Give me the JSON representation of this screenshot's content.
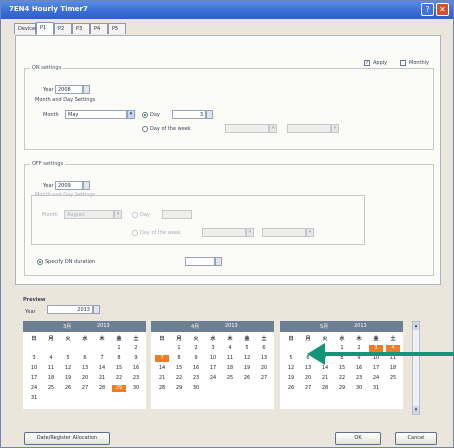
{
  "window": {
    "title": "7EN4 Hourly Timer7"
  },
  "tabs": [
    "Devices",
    "P1",
    "P2",
    "P3",
    "P4",
    "P5"
  ],
  "options": {
    "apply_label": "Apply",
    "monthly_label": "Monthly"
  },
  "on_settings": {
    "title": "ON settings",
    "year_label": "Year",
    "year_value": "2008",
    "month_day_title": "Month and Day Settings",
    "month_label": "Month",
    "month_value": "May",
    "day_label": "Day",
    "day_value": "3",
    "dow_label": "Day of the week"
  },
  "off_settings": {
    "title": "OFF settings",
    "year_label": "Year",
    "year_value": "2009",
    "month_day_title": "Month and Day Settings",
    "month_label": "Month",
    "month_value": "August",
    "day_label": "Day",
    "dow_label": "Day of the week",
    "duration_label": "Specify ON duration"
  },
  "preview": {
    "title": "Preview",
    "year_label": "Year",
    "year_value": "2013",
    "dow": [
      "日",
      "月",
      "火",
      "水",
      "木",
      "金",
      "土"
    ],
    "months": [
      {
        "name": "3月",
        "year": "2013",
        "rows": [
          [
            "",
            "",
            "",
            "",
            "",
            "1",
            "2"
          ],
          [
            "3",
            "4",
            "5",
            "6",
            "7",
            "8",
            "9"
          ],
          [
            "10",
            "11",
            "12",
            "13",
            "14",
            "15",
            "16"
          ],
          [
            "17",
            "18",
            "19",
            "20",
            "21",
            "22",
            "23"
          ],
          [
            "24",
            "25",
            "26",
            "27",
            "28",
            "29",
            "30"
          ],
          [
            "31",
            "",
            "",
            "",
            "",
            "",
            ""
          ]
        ],
        "highlight": [
          "29"
        ]
      },
      {
        "name": "4月",
        "year": "2013",
        "rows": [
          [
            "",
            "1",
            "2",
            "3",
            "4",
            "5",
            "6"
          ],
          [
            "7",
            "8",
            "9",
            "10",
            "11",
            "12",
            "13"
          ],
          [
            "14",
            "15",
            "16",
            "17",
            "18",
            "19",
            "20"
          ],
          [
            "21",
            "22",
            "23",
            "24",
            "25",
            "26",
            "27"
          ],
          [
            "28",
            "29",
            "30",
            "",
            "",
            "",
            ""
          ]
        ],
        "highlight": [
          "7"
        ]
      },
      {
        "name": "5月",
        "year": "2013",
        "rows": [
          [
            "",
            "",
            "",
            "1",
            "2",
            "3",
            "4"
          ],
          [
            "5",
            "6",
            "7",
            "8",
            "9",
            "10",
            "11"
          ],
          [
            "12",
            "13",
            "14",
            "15",
            "16",
            "17",
            "18"
          ],
          [
            "19",
            "20",
            "21",
            "22",
            "23",
            "24",
            "25"
          ],
          [
            "26",
            "27",
            "28",
            "29",
            "30",
            "31",
            ""
          ]
        ],
        "highlight": [
          "3",
          "4"
        ]
      }
    ]
  },
  "buttons": {
    "holiday": "Date/Register Allocation",
    "ok": "OK",
    "cancel": "Cancel"
  },
  "colors": {
    "highlight": "#ee7d26",
    "arrow": "#14957a"
  }
}
